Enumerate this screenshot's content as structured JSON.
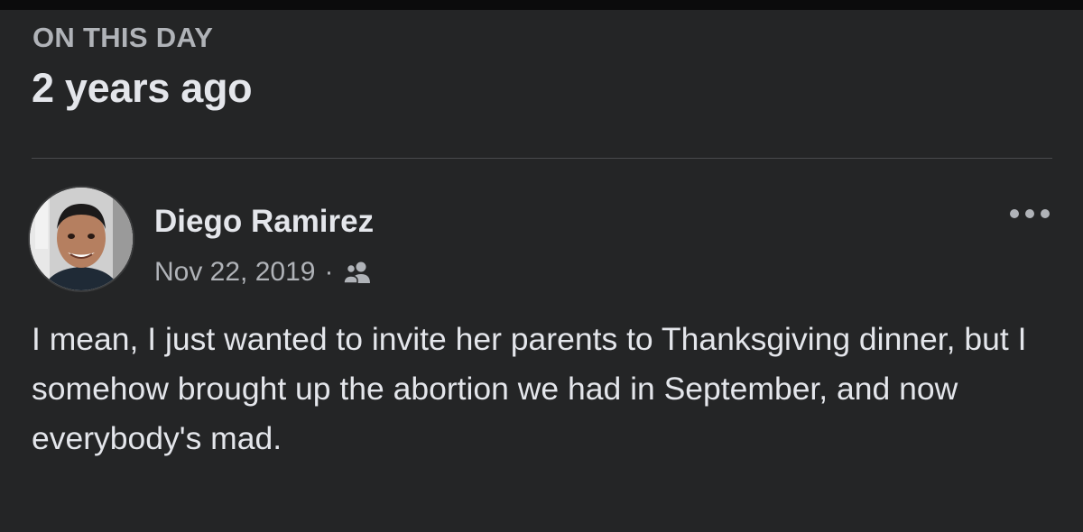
{
  "memory_header": {
    "label": "ON THIS DAY",
    "title": "2 years ago"
  },
  "post": {
    "author": "Diego Ramirez",
    "date": "Nov 22, 2019",
    "separator": "·",
    "audience_icon": "friends-icon",
    "menu_icon": "more-options-icon",
    "text": "I mean, I just wanted to invite her parents to Thanksgiving dinner, but I somehow brought up the abortion we had in September, and now everybody's mad."
  },
  "colors": {
    "background": "#242526",
    "primary_text": "#e4e6eb",
    "secondary_text": "#b0b3b8",
    "divider": "#4a4b4d"
  }
}
